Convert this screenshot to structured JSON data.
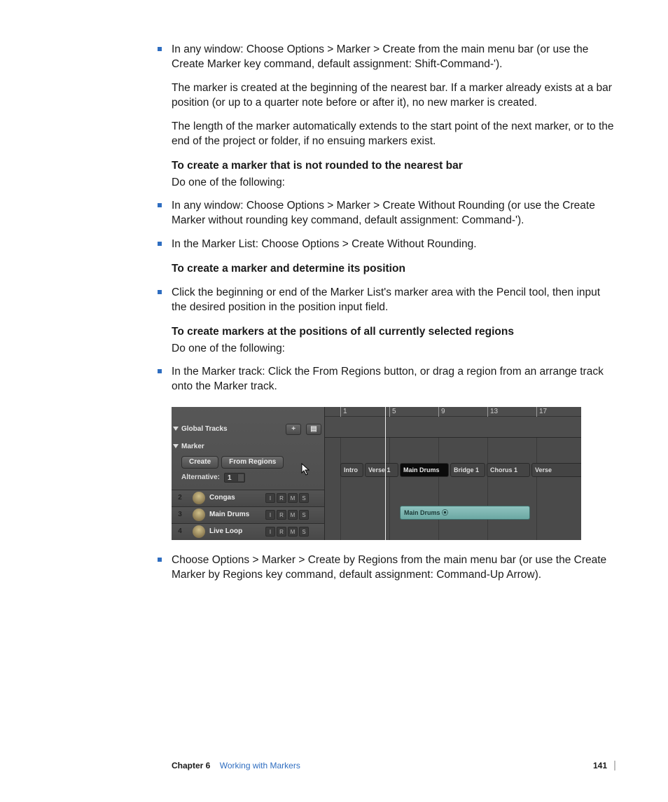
{
  "bullets": {
    "b1_a": "In any window:  Choose Options > Marker > Create from the main menu bar (or use the Create Marker key command, default assignment:  Shift-Command-').",
    "b1_p1": "The marker is created at the beginning of the nearest bar. If a marker already exists at a bar position (or up to a quarter note before or after it), no new marker is created.",
    "b1_p2": "The length of the marker automatically extends to the start point of the next marker, or to the end of the project or folder, if no ensuing markers exist.",
    "h2": "To create a marker that is not rounded to the nearest bar",
    "h2_sub": "Do one of the following:",
    "b2": "In any window:  Choose Options > Marker > Create Without Rounding (or use the Create Marker without rounding key command, default assignment:  Command-').",
    "b3": "In the Marker List:  Choose Options > Create Without Rounding.",
    "h3": "To create a marker and determine its position",
    "b4": "Click the beginning or end of the Marker List's marker area with the Pencil tool, then input the desired position in the position input field.",
    "h4": "To create markers at the positions of all currently selected regions",
    "h4_sub": "Do one of the following:",
    "b5": "In the Marker track:  Click the From Regions button, or drag a region from an arrange track onto the Marker track.",
    "b6": "Choose Options > Marker > Create by Regions from the main menu bar (or use the Create Marker by Regions key command, default assignment:  Command-Up Arrow)."
  },
  "shot": {
    "globalTracks": "Global Tracks",
    "marker": "Marker",
    "create": "Create",
    "fromRegions": "From Regions",
    "alternative": "Alternative:",
    "altVal": "1",
    "ruler": [
      "1",
      "5",
      "9",
      "13",
      "17"
    ],
    "markers": [
      "Intro",
      "Verse 1",
      "Main Drums",
      "Bridge 1",
      "Chorus 1",
      "Verse"
    ],
    "tracks": [
      {
        "n": "2",
        "name": "Congas"
      },
      {
        "n": "3",
        "name": "Main Drums"
      },
      {
        "n": "4",
        "name": "Live Loop"
      }
    ],
    "regionLabel": "Main Drums ⦿",
    "btns": [
      "I",
      "R",
      "M",
      "S"
    ]
  },
  "footer": {
    "chapter": "Chapter 6",
    "title": "Working with Markers",
    "page": "141"
  }
}
